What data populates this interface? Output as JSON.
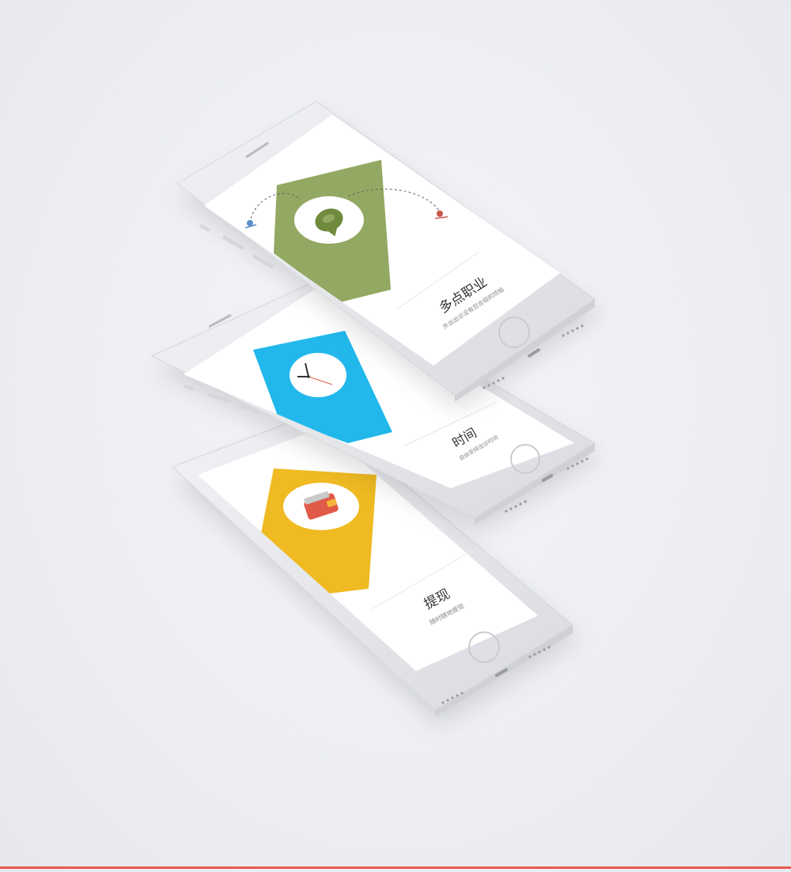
{
  "accent_bottom": "#e8584e",
  "device_color": "#e6e7eb",
  "screens": [
    {
      "title": "多点职业",
      "subtitle": "外出出诊没有您合规的烦恼",
      "card_color": "#93a862",
      "icon": "location-pin-icon",
      "icon_color": "#6f8a3c"
    },
    {
      "title": "时间",
      "subtitle": "自由安排出诊时间",
      "card_color": "#22b8ec",
      "icon": "clock-icon"
    },
    {
      "title": "提现",
      "subtitle": "随时随地提现",
      "card_color": "#efba22",
      "icon": "wallet-icon",
      "icon_color": "#e05a48"
    }
  ]
}
